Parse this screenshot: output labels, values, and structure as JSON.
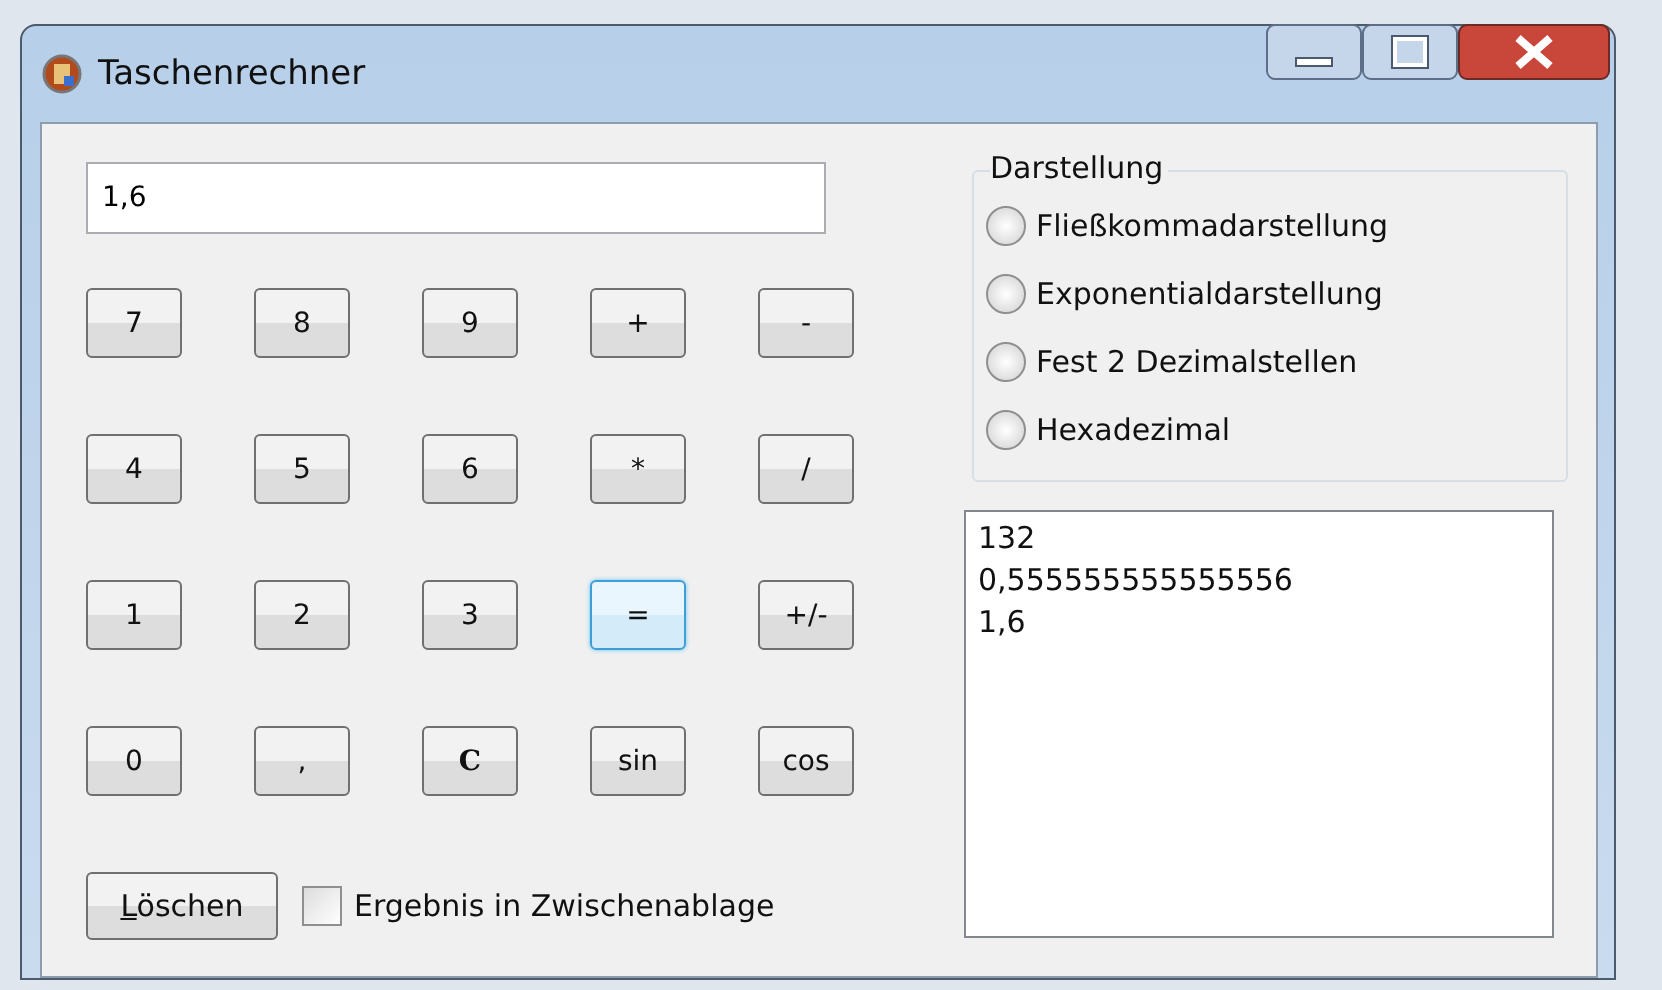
{
  "window": {
    "title": "Taschenrechner"
  },
  "display": {
    "value": "1,6"
  },
  "keys": [
    {
      "label": "7",
      "focused": false
    },
    {
      "label": "8",
      "focused": false
    },
    {
      "label": "9",
      "focused": false
    },
    {
      "label": "+",
      "focused": false
    },
    {
      "label": "-",
      "focused": false
    },
    {
      "label": "4",
      "focused": false
    },
    {
      "label": "5",
      "focused": false
    },
    {
      "label": "6",
      "focused": false
    },
    {
      "label": "*",
      "focused": false
    },
    {
      "label": "/",
      "focused": false
    },
    {
      "label": "1",
      "focused": false
    },
    {
      "label": "2",
      "focused": false
    },
    {
      "label": "3",
      "focused": false
    },
    {
      "label": "=",
      "focused": true
    },
    {
      "label": "+/-",
      "focused": false
    },
    {
      "label": "0",
      "focused": false
    },
    {
      "label": ",",
      "focused": false
    },
    {
      "label": "C",
      "focused": false
    },
    {
      "label": "sin",
      "focused": false
    },
    {
      "label": "cos",
      "focused": false
    }
  ],
  "clear_button": {
    "label": "Löschen"
  },
  "clipboard_checkbox": {
    "label": "Ergebnis in Zwischenablage",
    "checked": false
  },
  "display_mode": {
    "title": "Darstellung",
    "options": [
      {
        "label": "Fließkommadarstellung",
        "selected": false
      },
      {
        "label": "Exponentialdarstellung",
        "selected": false
      },
      {
        "label": "Fest 2 Dezimalstellen",
        "selected": false
      },
      {
        "label": "Hexadezimal",
        "selected": false
      }
    ]
  },
  "history": [
    "132",
    "0,555555555555556",
    "1,6"
  ]
}
